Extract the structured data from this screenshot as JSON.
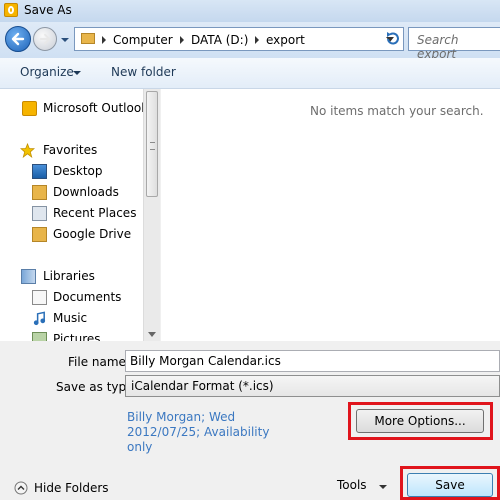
{
  "window": {
    "title": "Save As"
  },
  "address": {
    "crumbs": [
      "Computer",
      "DATA (D:)",
      "export"
    ],
    "search_placeholder": "Search export"
  },
  "toolbar": {
    "organize_label": "Organize",
    "new_folder_label": "New folder"
  },
  "nav": {
    "items": [
      {
        "label": "Microsoft Outlook",
        "icon": "outlook-icon"
      },
      {
        "label": "Favorites",
        "icon": "star-icon"
      },
      {
        "label": "Desktop",
        "icon": "desktop-icon"
      },
      {
        "label": "Downloads",
        "icon": "downloads-folder-icon"
      },
      {
        "label": "Recent Places",
        "icon": "recent-places-icon"
      },
      {
        "label": "Google Drive",
        "icon": "google-drive-folder-icon"
      },
      {
        "label": "Libraries",
        "icon": "libraries-icon"
      },
      {
        "label": "Documents",
        "icon": "documents-icon"
      },
      {
        "label": "Music",
        "icon": "music-icon"
      },
      {
        "label": "Pictures",
        "icon": "pictures-icon"
      }
    ]
  },
  "content": {
    "empty_message": "No items match your search."
  },
  "form": {
    "filename_label": "File name:",
    "filename_value": "Billy Morgan Calendar.ics",
    "savetype_label": "Save as type:",
    "savetype_value": "iCalendar Format (*.ics)",
    "details_lines": [
      "Billy Morgan; Wed",
      "2012/07/25; Availability",
      "only"
    ],
    "more_options_label": "More Options...",
    "hide_folders_label": "Hide Folders",
    "tools_label": "Tools",
    "save_label": "Save"
  },
  "colors": {
    "highlight": "#e0141c",
    "link_blue": "#3b78c1"
  }
}
